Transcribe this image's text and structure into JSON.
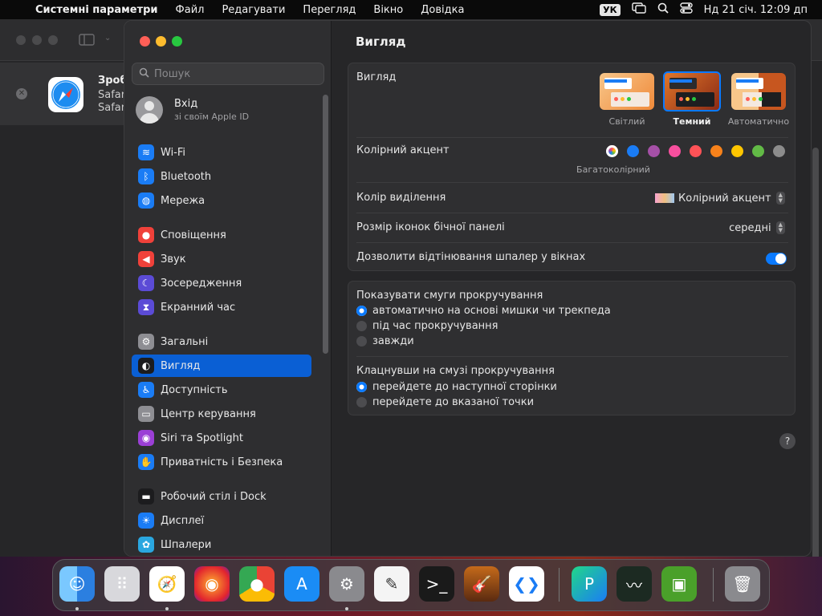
{
  "menubar": {
    "app_name": "Системні параметри",
    "menus": [
      "Файл",
      "Редагувати",
      "Перегляд",
      "Вікно",
      "Довідка"
    ],
    "keyboard_layout": "УК",
    "datetime": "Нд 21 січ.  12:09 дп"
  },
  "background_window": {
    "title": "Зроб",
    "line1": "Safar",
    "line2": "Safar"
  },
  "sidebar": {
    "search_placeholder": "Пошук",
    "account_title": "Вхід",
    "account_subtitle": "зі своїм Apple ID",
    "items": [
      {
        "label": "Wi-Fi",
        "icon": "wifi-icon",
        "color": "#1a7cf5"
      },
      {
        "label": "Bluetooth",
        "icon": "bluetooth-icon",
        "color": "#1a7cf5"
      },
      {
        "label": "Мережа",
        "icon": "globe-icon",
        "color": "#1a7cf5"
      },
      {
        "label": "Сповіщення",
        "icon": "bell-icon",
        "color": "#f0413a"
      },
      {
        "label": "Звук",
        "icon": "speaker-icon",
        "color": "#f0413a"
      },
      {
        "label": "Зосередження",
        "icon": "moon-icon",
        "color": "#5b4bd6"
      },
      {
        "label": "Екранний час",
        "icon": "hourglass-icon",
        "color": "#5b4bd6"
      },
      {
        "label": "Загальні",
        "icon": "gear-icon",
        "color": "#8e8e93"
      },
      {
        "label": "Вигляд",
        "icon": "appearance-icon",
        "color": "#1c1c1e"
      },
      {
        "label": "Доступність",
        "icon": "accessibility-icon",
        "color": "#1a7cf5"
      },
      {
        "label": "Центр керування",
        "icon": "control-center-icon",
        "color": "#8e8e93"
      },
      {
        "label": "Siri та Spotlight",
        "icon": "siri-icon",
        "color": "#9b3fd6"
      },
      {
        "label": "Приватність і Безпека",
        "icon": "hand-icon",
        "color": "#1a7cf5"
      },
      {
        "label": "Робочий стіл і Dock",
        "icon": "dock-icon",
        "color": "#1c1c1e"
      },
      {
        "label": "Дисплеї",
        "icon": "sun-icon",
        "color": "#1a7cf5"
      },
      {
        "label": "Шпалери",
        "icon": "flower-icon",
        "color": "#2aa7e0"
      }
    ]
  },
  "main": {
    "title": "Вигляд",
    "appearance_label": "Вигляд",
    "themes": [
      "Світлий",
      "Темний",
      "Автоматично"
    ],
    "accent_label": "Колірний акцент",
    "accent_selected_label": "Багатоколірний",
    "accent_colors": [
      "#8e44ff",
      "#1a7cf5",
      "#a550a7",
      "#f74f9e",
      "#ff5257",
      "#f7821b",
      "#ffc600",
      "#62ba46",
      "#8c8c8c"
    ],
    "highlight_label": "Колір виділення",
    "highlight_value": "Колірний акцент",
    "sidebar_icon_label": "Розмір іконок бічної панелі",
    "sidebar_icon_value": "середні",
    "tint_label": "Дозволити відтінювання шпалер у вікнах",
    "scrollbars_title": "Показувати смуги прокручування",
    "scrollbar_options": [
      "автоматично на основі мишки чи трекпеда",
      "під час прокручування",
      "завжди"
    ],
    "click_title": "Клацнувши на смузі прокручування",
    "click_options": [
      "перейдете до наступної сторінки",
      "перейдете до вказаної точки"
    ],
    "help": "?"
  },
  "dock": {
    "apps": [
      "finder-icon",
      "launchpad-icon",
      "safari-icon",
      "firefox-icon",
      "chrome-icon",
      "app-store-icon",
      "system-settings-icon",
      "textedit-icon",
      "terminal-icon",
      "garageband-icon",
      "vscode-icon",
      "pycharm-icon",
      "activity-monitor-icon",
      "minecraft-icon",
      "trash-icon"
    ]
  }
}
